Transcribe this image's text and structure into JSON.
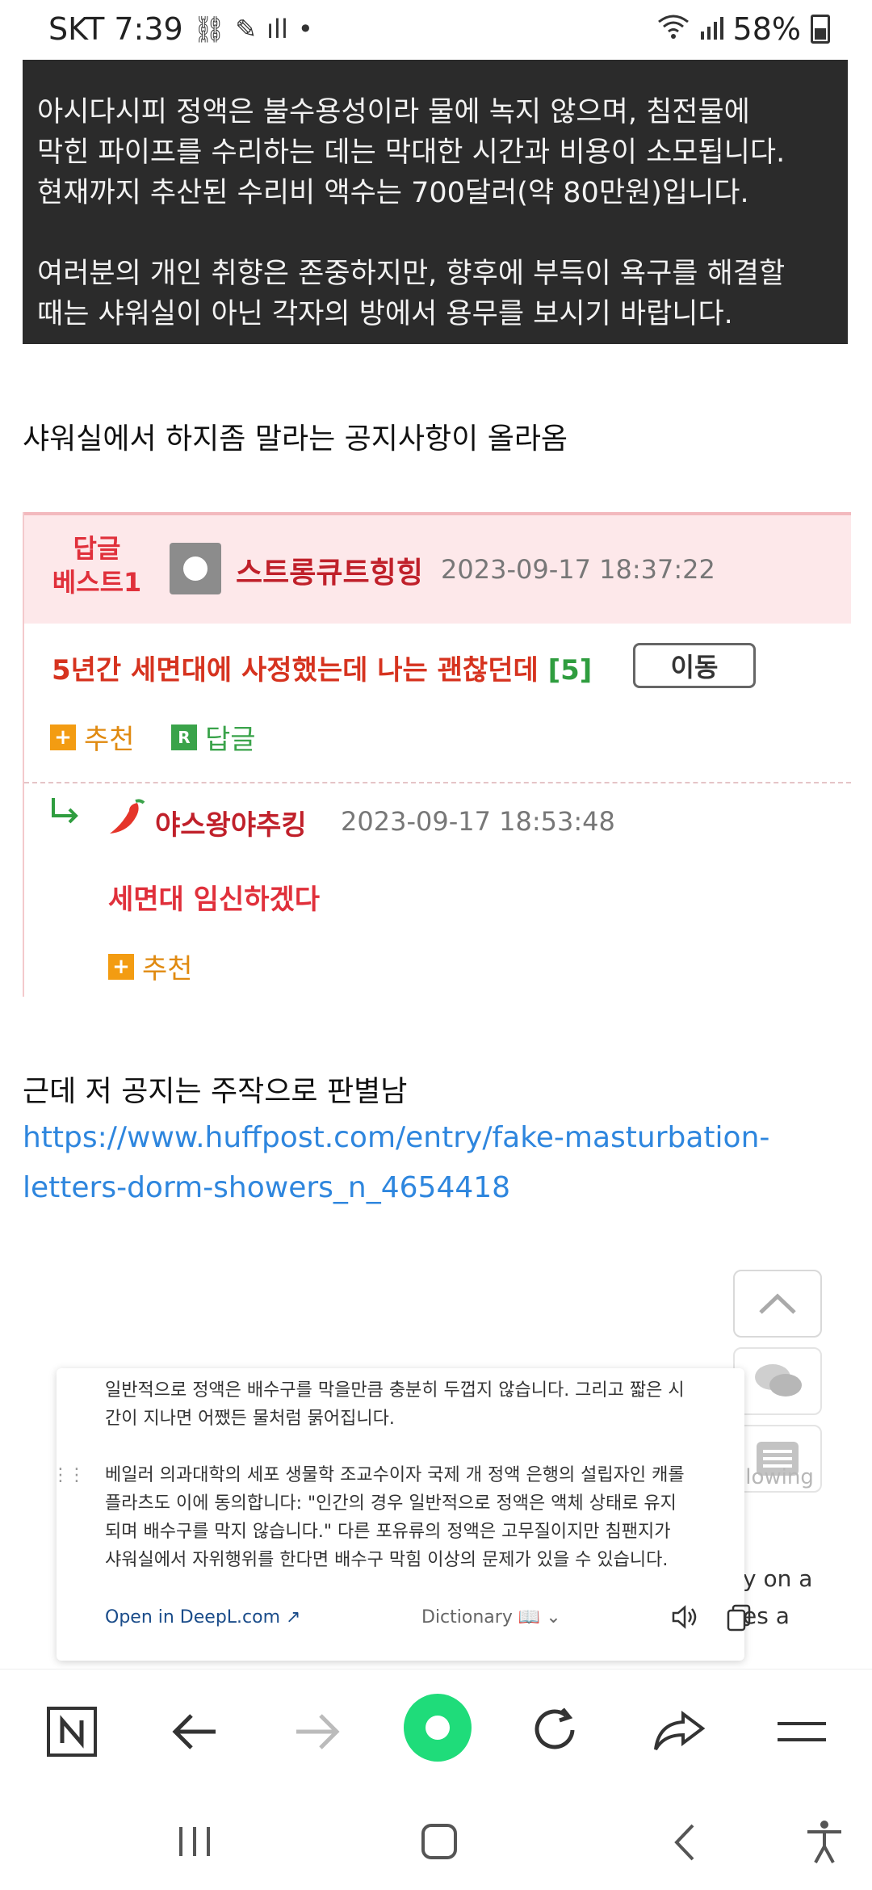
{
  "status_bar": {
    "time": "SKT 7:39",
    "battery": "58%"
  },
  "notice": {
    "para1": [
      "아시다시피 정액은 불수용성이라 물에 녹지 않으며, 침전물에",
      "막힌 파이프를 수리하는 데는 막대한 시간과 비용이 소모됩니다.",
      "현재까지 추산된 수리비 액수는 700달러(약 80만원)입니다."
    ],
    "para2": [
      "여러분의 개인 취향은 존중하지만, 향후에 부득이 욕구를 해결할",
      "때는 샤워실이 아닌 각자의 방에서 용무를 보시기 바랍니다."
    ]
  },
  "post": {
    "caption1": "샤워실에서 하지좀 말라는 공지사항이 올라옴",
    "caption2": "근데 저 공지는 주작으로 판별남",
    "link_line1": "https://www.huffpost.com/entry/fake-masturbation-",
    "link_line2": "letters-dorm-showers_n_4654418"
  },
  "comment_card": {
    "best_label_line1": "답글",
    "best_label_line2": "베스트1",
    "author": "스트롱큐트힝힝",
    "date": "2023-09-17 18:37:22",
    "title": "5년간 세면대에 사정했는데 나는 괜찮던데",
    "count": "[5]",
    "move_button": "이동",
    "recommend_label": "추천",
    "reply_label": "답글",
    "reply": {
      "author": "야스왕야추킹",
      "date": "2023-09-17 18:53:48",
      "text": "세면대 임신하겠다",
      "recommend_label": "추천"
    }
  },
  "deepl_popup": {
    "para1": [
      "일반적으로 정액은 배수구를 막을만큼 충분히 두껍지 않습니다. 그리고 짧은 시",
      "간이 지나면 어쨌든 물처럼 묽어집니다."
    ],
    "para2": [
      "베일러 의과대학의 세포 생물학 조교수이자 국제 개 정액 은행의 설립자인 캐롤",
      "플라츠도 이에 동의합니다: \"인간의 경우 일반적으로 정액은 액체 상태로 유지",
      "되며 배수구를 막지 않습니다.\" 다른 포유류의 정액은 고무질이지만 침팬지가",
      "샤워실에서 자위행위를 한다면 배수구 막힘 이상의 문제가 있을 수 있습니다."
    ],
    "open_link": "Open in DeepL.com",
    "dictionary": "Dictionary"
  },
  "behind_text": {
    "following": "llowing",
    "line_a": "y on a",
    "line_b": "es a"
  },
  "colors": {
    "accent_green": "#1fdc7a",
    "link_blue": "#2e86de",
    "best_red": "#e0303b"
  }
}
